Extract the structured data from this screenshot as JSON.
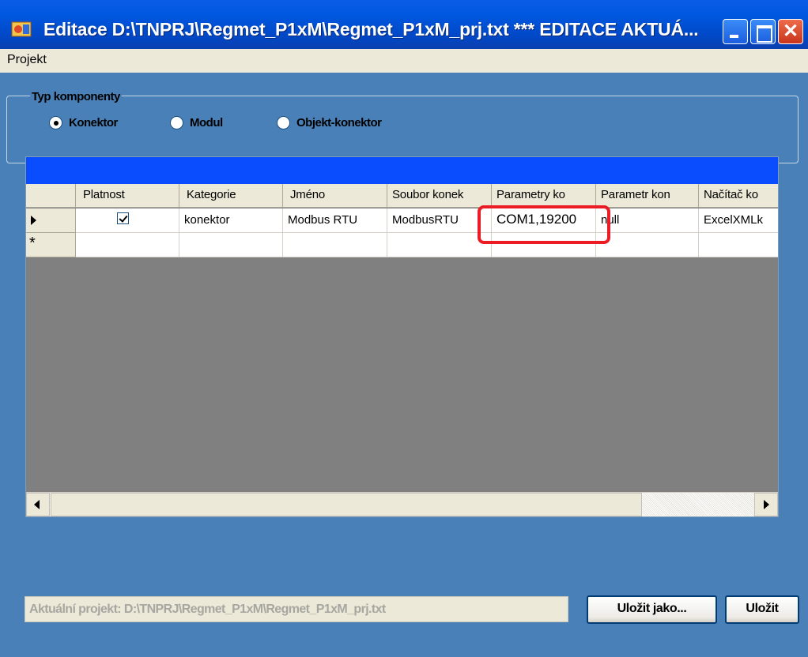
{
  "window": {
    "title": "Editace D:\\TNPRJ\\Regmet_P1xM\\Regmet_P1xM_prj.txt   *** EDITACE AKTUÁ..."
  },
  "menu": {
    "items": [
      {
        "label": "Projekt"
      }
    ]
  },
  "component_type": {
    "title": "Typ komponenty",
    "options": [
      {
        "label": "Konektor",
        "selected": true
      },
      {
        "label": "Modul",
        "selected": false
      },
      {
        "label": "Objekt-konektor",
        "selected": false
      }
    ]
  },
  "grid": {
    "columns": [
      "Platnost",
      "Kategorie",
      "Jméno",
      "Soubor konek",
      "Parametry ko",
      "Parametr kon",
      "Načítač ko"
    ],
    "rows": [
      {
        "platnost": true,
        "kategorie": "konektor",
        "jmeno": "Modbus RTU",
        "soubor": "ModbusRTU",
        "parametry": "COM1,19200",
        "parametr": "null",
        "nacitac": "ExcelXMLk"
      }
    ],
    "new_row_marker": "*"
  },
  "status": {
    "project_path": "Aktuální projekt: D:\\TNPRJ\\Regmet_P1xM\\Regmet_P1xM_prj.txt"
  },
  "buttons": {
    "save_as": "Uložit jako...",
    "save": "Uložit"
  },
  "colors": {
    "titlebar": "#0058e0",
    "client": "#4a80b8",
    "grid_bg": "#808080",
    "grid_caption": "#0a4dff",
    "highlight": "#ec1c24"
  }
}
